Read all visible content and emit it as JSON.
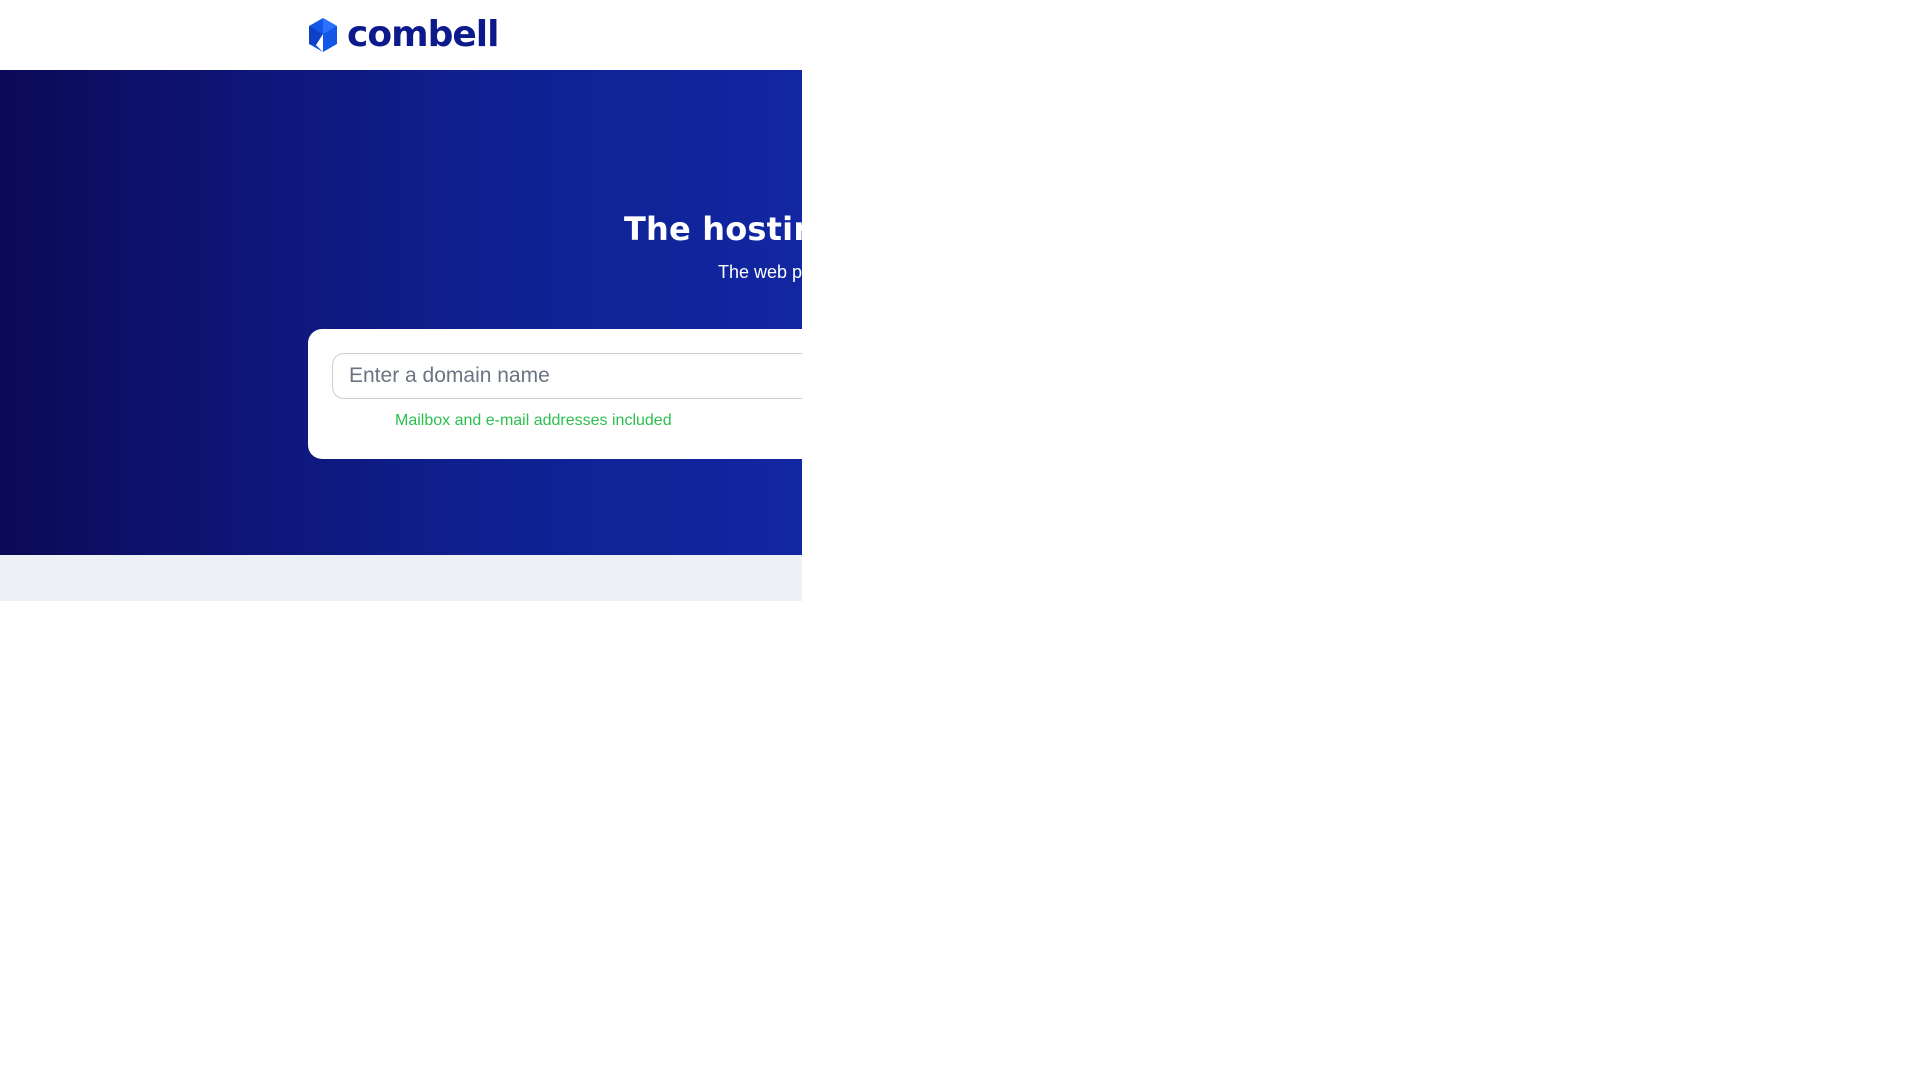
{
  "header": {
    "logo_text": "combell",
    "logo_icon": "combell-logo-mark"
  },
  "hero": {
    "title": "The hosting",
    "subtitle": "The web p"
  },
  "search": {
    "placeholder": "Enter a domain name",
    "perk": "Mailbox and e-mail addresses included"
  },
  "colors": {
    "brand_navy": "#0d1a8c",
    "brand_blue": "#1457e6",
    "hero_dark": "#0c0a57",
    "hero_light": "#1126a1",
    "perk_green": "#2dbf4e",
    "band_gray": "#edf1f5"
  }
}
